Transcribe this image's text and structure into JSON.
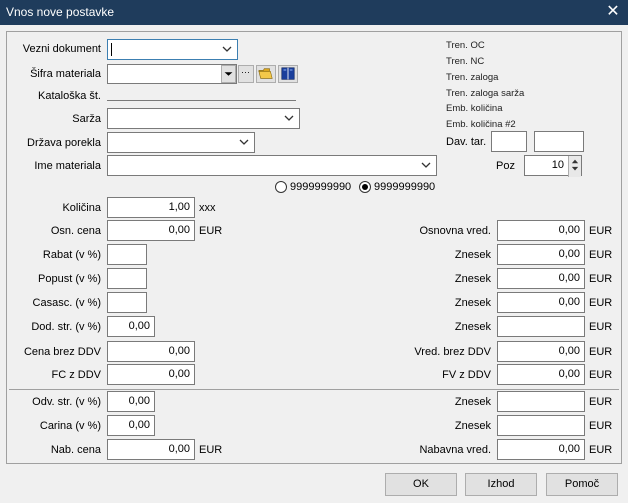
{
  "window": {
    "title": "Vnos nove postavke",
    "close_glyph": "✕"
  },
  "left_labels": {
    "vezni_dokument": "Vezni dokument",
    "sifra_materiala": "Šifra materiala",
    "kataloska": "Kataloška št.",
    "sarza": "Sarža",
    "drzava_porekla": "Država porekla",
    "ime_materiala": "Ime materiala"
  },
  "info_labels": {
    "tren_oc": "Tren. OC",
    "tren_nc": "Tren. NC",
    "tren_zaloga": "Tren. zaloga",
    "tren_zaloga_sarza": "Tren. zaloga sarža",
    "emb_kolicina": "Emb. količina",
    "emb_kolicina_2": "Emb. količina #2"
  },
  "dav_tar": {
    "label": "Dav. tar."
  },
  "poz": {
    "label": "Poz",
    "value": "10"
  },
  "radios": [
    {
      "label": "9999999990",
      "selected": false
    },
    {
      "label": "9999999990",
      "selected": true
    }
  ],
  "fields_left": {
    "kolicina": {
      "label": "Količina",
      "value": "1,00",
      "unit": "xxx"
    },
    "osn_cena": {
      "label": "Osn. cena",
      "value": "0,00",
      "unit": "EUR"
    },
    "rabat": {
      "label": "Rabat (v %)",
      "value": ""
    },
    "popust": {
      "label": "Popust (v %)",
      "value": ""
    },
    "casasc": {
      "label": "Casasc. (v %)",
      "value": ""
    },
    "dod_str": {
      "label": "Dod. str. (v %)",
      "value": "0,00"
    },
    "cena_brez_ddv": {
      "label": "Cena brez DDV",
      "value": "0,00"
    },
    "fc_z_ddv": {
      "label": "FC z DDV",
      "value": "0,00"
    },
    "odv_str": {
      "label": "Odv. str. (v %)",
      "value": "0,00"
    },
    "carina": {
      "label": "Carina (v %)",
      "value": "0,00"
    },
    "nab_cena": {
      "label": "Nab. cena",
      "value": "0,00",
      "unit": "EUR"
    }
  },
  "fields_right": {
    "osnovna_vred": {
      "label": "Osnovna vred.",
      "value": "0,00",
      "unit": "EUR"
    },
    "znesek1": {
      "label": "Znesek",
      "value": "0,00",
      "unit": "EUR"
    },
    "znesek2": {
      "label": "Znesek",
      "value": "0,00",
      "unit": "EUR"
    },
    "znesek3": {
      "label": "Znesek",
      "value": "0,00",
      "unit": "EUR"
    },
    "znesek4": {
      "label": "Znesek",
      "value": "",
      "unit": "EUR"
    },
    "vred_brez_ddv": {
      "label": "Vred. brez DDV",
      "value": "0,00",
      "unit": "EUR"
    },
    "fv_z_ddv": {
      "label": "FV z DDV",
      "value": "0,00",
      "unit": "EUR"
    },
    "znesek5": {
      "label": "Znesek",
      "value": "",
      "unit": "EUR"
    },
    "znesek6": {
      "label": "Znesek",
      "value": "",
      "unit": "EUR"
    },
    "nabavna_vred": {
      "label": "Nabavna vred.",
      "value": "0,00",
      "unit": "EUR"
    }
  },
  "buttons": {
    "ok": "OK",
    "izhod": "Izhod",
    "pomoc": "Pomoč",
    "ellipsis": "···"
  },
  "icons": {
    "folder": "folder-open-icon",
    "book": "book-icon"
  }
}
